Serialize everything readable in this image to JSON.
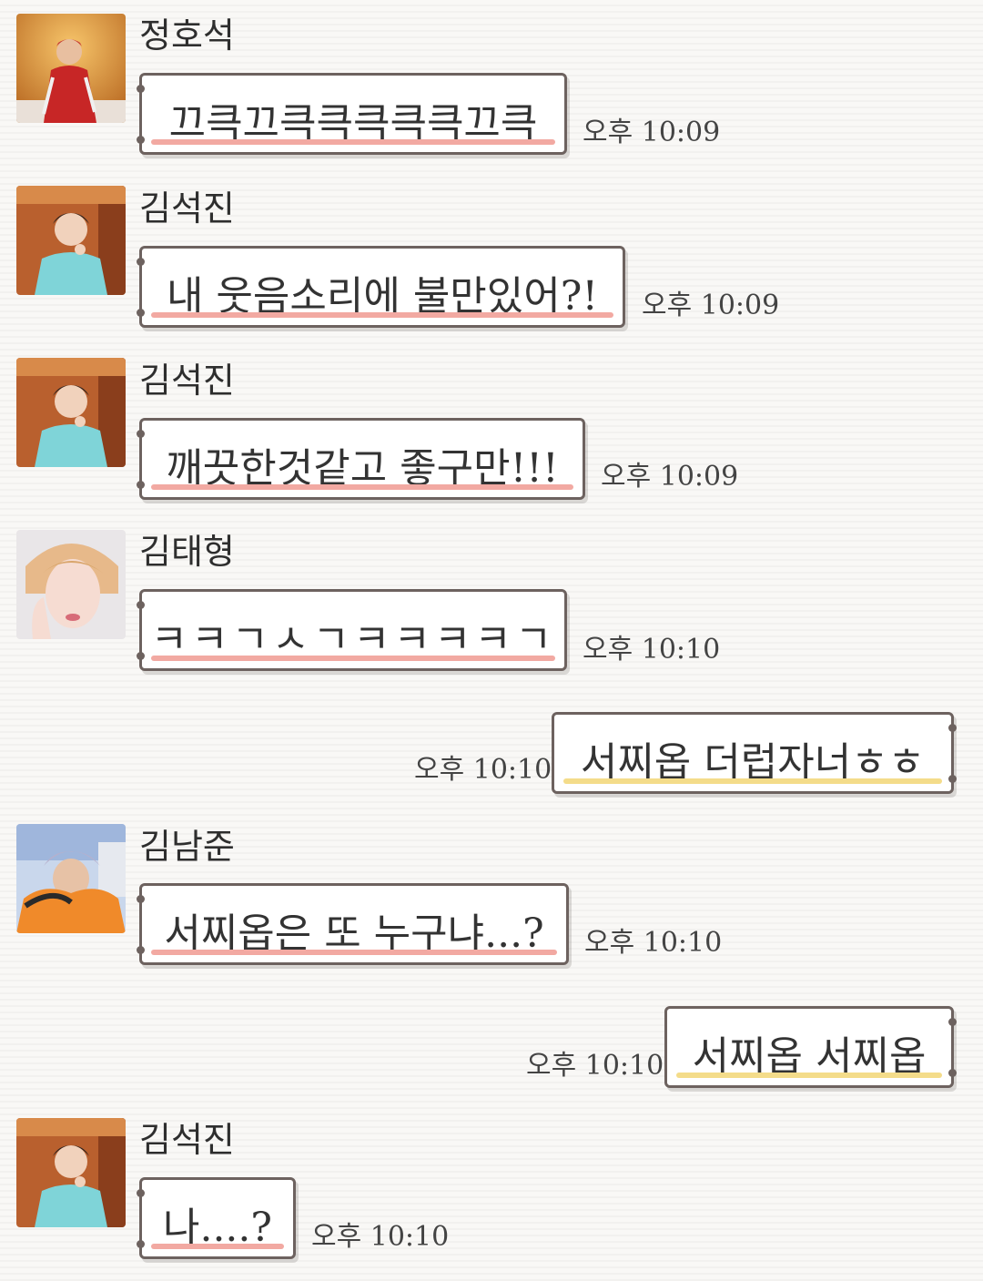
{
  "colors": {
    "pink_underline": "#f2a9a2",
    "yellow_underline": "#f4dc8a",
    "bubble_border": "#6d625f"
  },
  "messages": [
    {
      "sender": "정호석",
      "text": "끄큭끄큭큭큭큭큭끄큭",
      "time": "오후 10:09"
    },
    {
      "sender": "김석진",
      "text": "내 웃음소리에 불만있어?!",
      "time": "오후 10:09"
    },
    {
      "sender": "김석진",
      "text": "깨끗한것같고 좋구만!!!",
      "time": "오후 10:09"
    },
    {
      "sender": "김태형",
      "text": "ㅋㅋㄱㅅㄱㅋㅋㅋㅋㄱ",
      "time": "오후 10:10"
    },
    {
      "sender": "",
      "text": "서찌옵 더럽자너ㅎㅎ",
      "time": "오후 10:10"
    },
    {
      "sender": "김남준",
      "text": "서찌옵은 또 누구냐...?",
      "time": "오후 10:10"
    },
    {
      "sender": "",
      "text": "서찌옵 서찌옵",
      "time": "오후 10:10"
    },
    {
      "sender": "김석진",
      "text": "나....?",
      "time": "오후 10:10"
    }
  ]
}
